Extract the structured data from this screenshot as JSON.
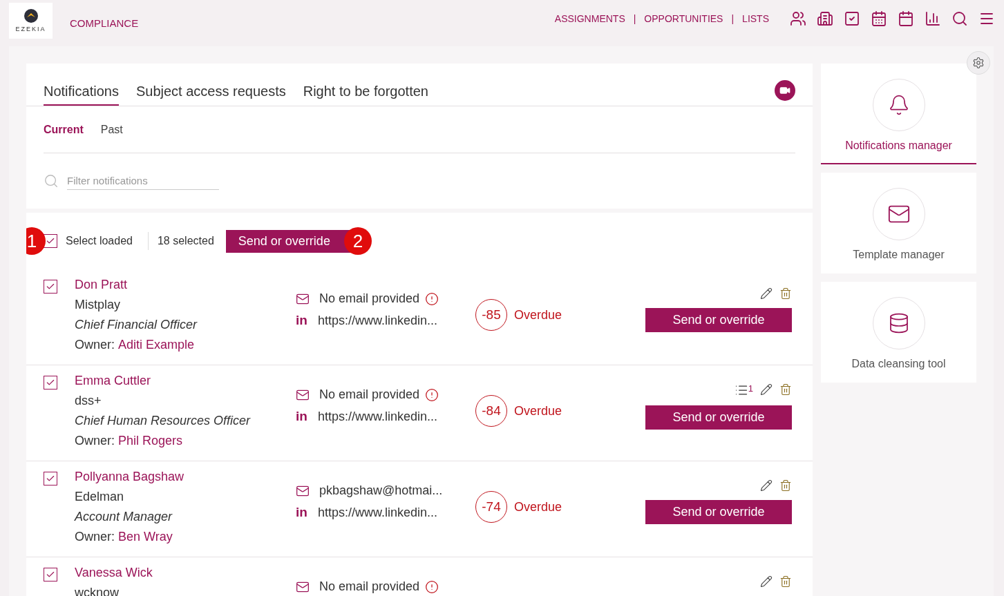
{
  "brand": {
    "logo_text": "EZEKIA",
    "section": "COMPLIANCE"
  },
  "nav": {
    "links": [
      {
        "label": "ASSIGNMENTS"
      },
      {
        "label": "OPPORTUNITIES"
      },
      {
        "label": "LISTS"
      }
    ],
    "separator": "|"
  },
  "tabs": [
    {
      "label": "Notifications",
      "selected": true
    },
    {
      "label": "Subject access requests",
      "selected": false
    },
    {
      "label": "Right to be forgotten",
      "selected": false
    }
  ],
  "subtabs": [
    {
      "label": "Current",
      "selected": true
    },
    {
      "label": "Past",
      "selected": false
    }
  ],
  "filter": {
    "placeholder": "Filter notifications"
  },
  "bulk": {
    "select_label": "Select loaded",
    "checked": true,
    "count": "18 selected",
    "button": "Send or override",
    "markers": [
      "1",
      "2"
    ]
  },
  "rows": [
    {
      "checked": true,
      "name": "Don Pratt",
      "company": "Mistplay",
      "title": "Chief Financial Officer",
      "owner_label": "Owner:",
      "owner": "Aditi Example",
      "email": "No email provided",
      "email_missing": true,
      "linkedin_icon": "in",
      "linkedin": "https://www.linkedin...",
      "days": "-85",
      "status": "Overdue",
      "button": "Send or override"
    },
    {
      "checked": true,
      "name": "Emma Cuttler",
      "company": "dss+",
      "title": "Chief Human Resources Officer",
      "owner_label": "Owner:",
      "owner": "Phil Rogers",
      "email": "No email provided",
      "email_missing": true,
      "linkedin_icon": "in",
      "linkedin": "https://www.linkedin...",
      "days": "-84",
      "status": "Overdue",
      "notes": "1",
      "button": "Send or override"
    },
    {
      "checked": true,
      "name": "Pollyanna Bagshaw",
      "company": "Edelman",
      "title": "Account Manager",
      "owner_label": "Owner:",
      "owner": "Ben Wray",
      "email": "pkbagshaw@hotmai...",
      "email_missing": false,
      "linkedin_icon": "in",
      "linkedin": "https://www.linkedin...",
      "days": "-74",
      "status": "Overdue",
      "button": "Send or override"
    },
    {
      "checked": true,
      "name": "Vanessa Wick",
      "company": "wcknow",
      "email": "No email provided",
      "email_missing": true
    }
  ],
  "tools": [
    {
      "label": "Notifications manager",
      "kind": "bell",
      "selected": true
    },
    {
      "label": "Template manager",
      "kind": "envelope",
      "selected": false
    },
    {
      "label": "Data cleansing tool",
      "kind": "database",
      "selected": false
    }
  ]
}
